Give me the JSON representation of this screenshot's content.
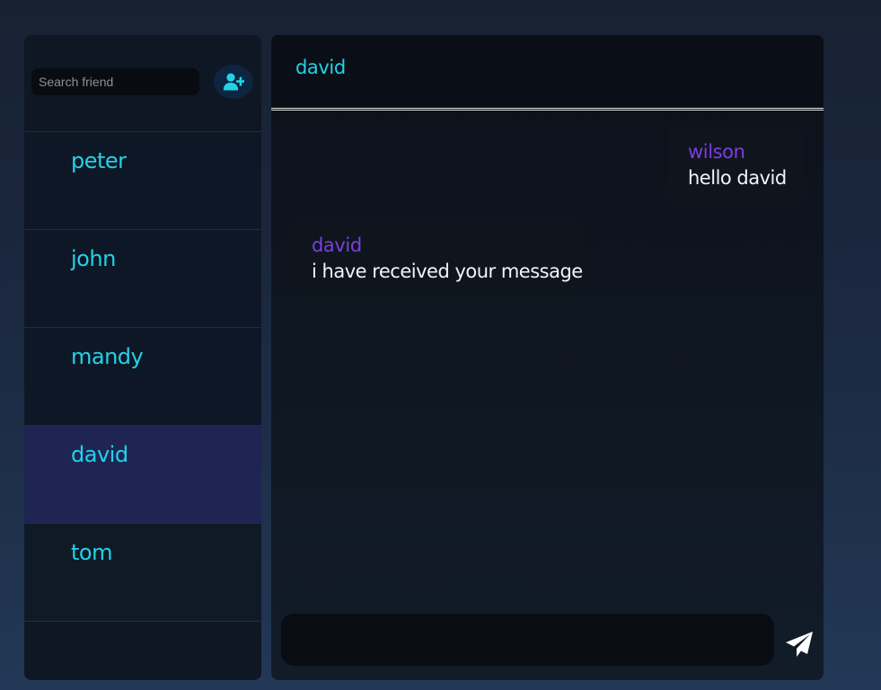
{
  "sidebar": {
    "search": {
      "placeholder": "Search friend",
      "value": ""
    },
    "add_friend_icon": "user-plus-icon",
    "friends": [
      {
        "name": "peter",
        "active": false
      },
      {
        "name": "john",
        "active": false
      },
      {
        "name": "mandy",
        "active": false
      },
      {
        "name": "david",
        "active": true
      },
      {
        "name": "tom",
        "active": false
      }
    ]
  },
  "chat": {
    "title": "david",
    "messages": [
      {
        "direction": "sent",
        "sender": "wilson",
        "text": "hello david"
      },
      {
        "direction": "received",
        "sender": "david",
        "text": "i have received your message"
      }
    ],
    "composer": {
      "placeholder": "",
      "value": ""
    },
    "send_icon": "paper-plane-icon"
  },
  "colors": {
    "accent_cyan": "#22d3e8",
    "sender_purple": "#7c3ee0",
    "active_item": "#1f2553",
    "panel": "#0f1724"
  }
}
